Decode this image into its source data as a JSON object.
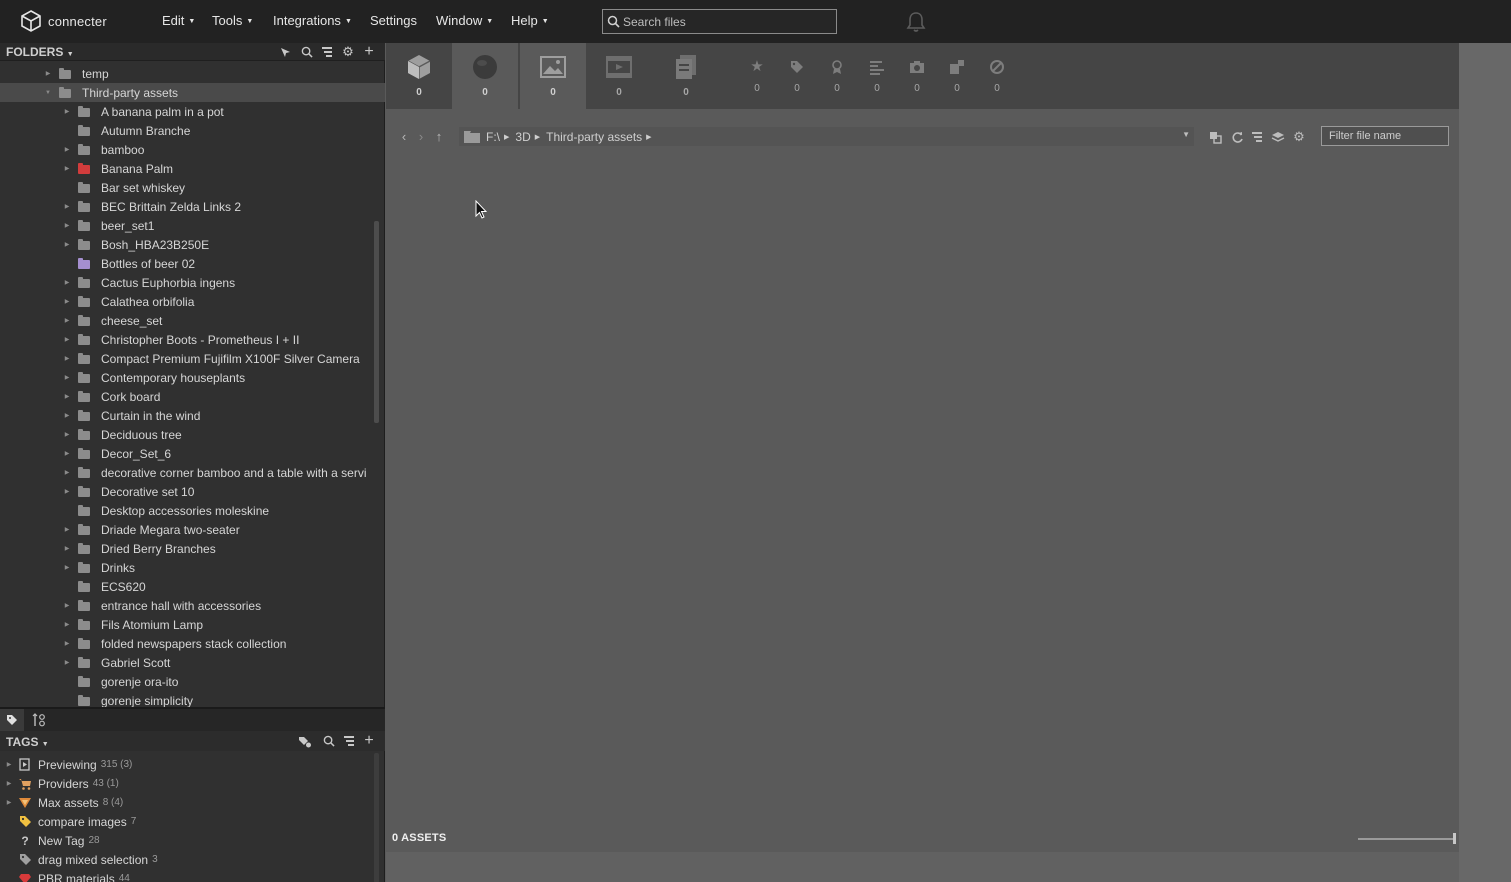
{
  "app": {
    "name": "connecter"
  },
  "menu": [
    {
      "label": "Edit",
      "dropdown": true
    },
    {
      "label": "Tools",
      "dropdown": true
    },
    {
      "label": "Integrations",
      "dropdown": true
    },
    {
      "label": "Settings",
      "dropdown": false
    },
    {
      "label": "Window",
      "dropdown": true
    },
    {
      "label": "Help",
      "dropdown": true
    }
  ],
  "search": {
    "placeholder": "Search files",
    "value": ""
  },
  "folders": {
    "title": "FOLDERS",
    "items": [
      {
        "label": "temp",
        "level": 1,
        "expandable": true
      },
      {
        "label": "Third-party assets",
        "level": 1,
        "expandable": true,
        "expanded": true,
        "selected": true
      },
      {
        "label": "A banana palm in a pot",
        "level": 2,
        "expandable": true
      },
      {
        "label": "Autumn Branche",
        "level": 2,
        "expandable": false
      },
      {
        "label": "bamboo",
        "level": 2,
        "expandable": true
      },
      {
        "label": "Banana Palm",
        "level": 2,
        "expandable": true,
        "color": "#d23c3c"
      },
      {
        "label": "Bar set whiskey",
        "level": 2,
        "expandable": false
      },
      {
        "label": "BEC Brittain Zelda Links 2",
        "level": 2,
        "expandable": true
      },
      {
        "label": "beer_set1",
        "level": 2,
        "expandable": true
      },
      {
        "label": "Bosh_HBA23B250E",
        "level": 2,
        "expandable": true
      },
      {
        "label": "Bottles of beer 02",
        "level": 2,
        "expandable": false,
        "color": "#a58fd0"
      },
      {
        "label": "Cactus Euphorbia ingens",
        "level": 2,
        "expandable": true
      },
      {
        "label": "Calathea orbifolia",
        "level": 2,
        "expandable": true
      },
      {
        "label": "cheese_set",
        "level": 2,
        "expandable": true
      },
      {
        "label": "Christopher Boots - Prometheus I + II",
        "level": 2,
        "expandable": true
      },
      {
        "label": "Compact Premium Fujifilm X100F Silver Camera",
        "level": 2,
        "expandable": true
      },
      {
        "label": "Contemporary houseplants",
        "level": 2,
        "expandable": true
      },
      {
        "label": "Cork board",
        "level": 2,
        "expandable": true
      },
      {
        "label": "Curtain in the wind",
        "level": 2,
        "expandable": true
      },
      {
        "label": "Deciduous tree",
        "level": 2,
        "expandable": true
      },
      {
        "label": "Decor_Set_6",
        "level": 2,
        "expandable": true
      },
      {
        "label": "decorative corner bamboo and a table with a servi",
        "level": 2,
        "expandable": true
      },
      {
        "label": "Decorative set 10",
        "level": 2,
        "expandable": true
      },
      {
        "label": "Desktop accessories moleskine",
        "level": 2,
        "expandable": false
      },
      {
        "label": "Driade Megara two-seater",
        "level": 2,
        "expandable": true
      },
      {
        "label": "Dried Berry Branches",
        "level": 2,
        "expandable": true
      },
      {
        "label": "Drinks",
        "level": 2,
        "expandable": true
      },
      {
        "label": "ECS620",
        "level": 2,
        "expandable": false
      },
      {
        "label": "entrance hall with accessories",
        "level": 2,
        "expandable": true
      },
      {
        "label": "Fils Atomium Lamp",
        "level": 2,
        "expandable": true
      },
      {
        "label": "folded newspapers stack collection",
        "level": 2,
        "expandable": true
      },
      {
        "label": "Gabriel Scott",
        "level": 2,
        "expandable": true
      },
      {
        "label": "gorenje ora-ito",
        "level": 2,
        "expandable": false
      },
      {
        "label": "gorenje simplicity",
        "level": 2,
        "expandable": false
      }
    ]
  },
  "tags": {
    "title": "TAGS",
    "items": [
      {
        "label": "Previewing",
        "count": "315 (3)",
        "icon": "preview-icon",
        "expandable": true
      },
      {
        "label": "Providers",
        "count": "43 (1)",
        "icon": "cart-icon",
        "expandable": true
      },
      {
        "label": "Max assets",
        "count": "8 (4)",
        "icon": "max-icon",
        "expandable": true
      },
      {
        "label": "compare images",
        "count": "7",
        "icon": "tag-icon",
        "expandable": false
      },
      {
        "label": "New Tag",
        "count": "28",
        "icon": "question-icon",
        "expandable": false
      },
      {
        "label": "drag mixed selection",
        "count": "3",
        "icon": "tag-icon",
        "expandable": false
      },
      {
        "label": "PBR materials",
        "count": "44",
        "icon": "gem-icon",
        "expandable": false
      }
    ]
  },
  "types": [
    {
      "name": "3d-models",
      "count": "0",
      "icon": "cube-icon"
    },
    {
      "name": "materials",
      "count": "0",
      "icon": "sphere-icon"
    },
    {
      "name": "images",
      "count": "0",
      "icon": "image-icon"
    },
    {
      "name": "videos",
      "count": "0",
      "icon": "film-icon"
    },
    {
      "name": "documents",
      "count": "0",
      "icon": "document-icon"
    }
  ],
  "filters": [
    {
      "name": "favorites",
      "count": "0",
      "icon": "star-icon"
    },
    {
      "name": "tags",
      "count": "0",
      "icon": "tag-icon"
    },
    {
      "name": "awards",
      "count": "0",
      "icon": "award-icon"
    },
    {
      "name": "text",
      "count": "0",
      "icon": "lines-icon"
    },
    {
      "name": "camera",
      "count": "0",
      "icon": "camera-icon"
    },
    {
      "name": "puzzle",
      "count": "0",
      "icon": "puzzle-icon"
    },
    {
      "name": "excluded",
      "count": "0",
      "icon": "ban-icon"
    }
  ],
  "path": {
    "segments": [
      "F:\\",
      "3D",
      "Third-party assets"
    ]
  },
  "filter_name": {
    "placeholder": "Filter file name",
    "value": ""
  },
  "status": {
    "assets": "0 ASSETS"
  }
}
